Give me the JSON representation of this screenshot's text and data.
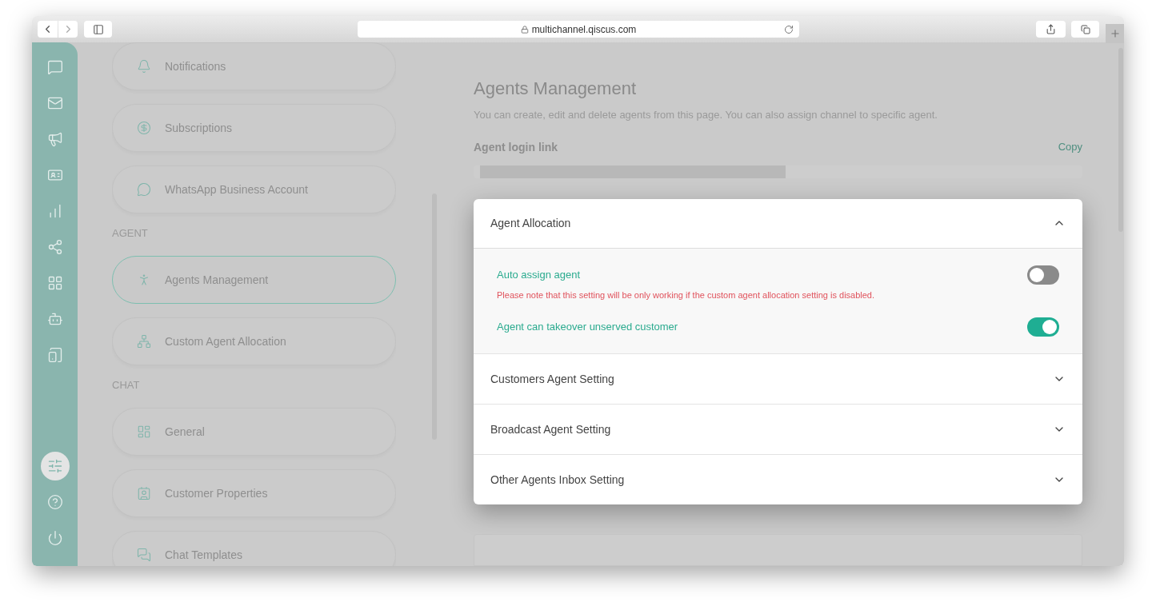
{
  "browser": {
    "url": "multichannel.qiscus.com"
  },
  "rail": {
    "top": [
      {
        "selected": false
      },
      {
        "selected": false
      },
      {
        "selected": false
      },
      {
        "selected": false
      },
      {
        "selected": false
      },
      {
        "selected": false
      },
      {
        "selected": false
      },
      {
        "selected": false
      },
      {
        "selected": false
      }
    ],
    "bottom": [
      {
        "selected": true
      },
      {
        "selected": false
      },
      {
        "selected": false
      }
    ]
  },
  "settings_menu": [
    {
      "items": [
        {
          "label": "Notifications",
          "selected": false
        },
        {
          "label": "Subscriptions",
          "selected": false
        },
        {
          "label": "WhatsApp Business Account",
          "selected": false
        }
      ]
    },
    {
      "heading": "AGENT",
      "items": [
        {
          "label": "Agents Management",
          "selected": true
        },
        {
          "label": "Custom Agent Allocation",
          "selected": false
        }
      ]
    },
    {
      "heading": "CHAT",
      "items": [
        {
          "label": "General",
          "selected": false
        },
        {
          "label": "Customer Properties",
          "selected": false
        },
        {
          "label": "Chat Templates",
          "selected": false
        }
      ]
    }
  ],
  "page": {
    "title": "Agents Management",
    "description": "You can create, edit and delete agents from this page. You can also assign channel to specific agent.",
    "login_link": {
      "label": "Agent login link",
      "action": "Copy"
    }
  },
  "modal": {
    "panels": [
      {
        "title": "Agent Allocation",
        "expanded": true,
        "settings": [
          {
            "label": "Auto assign agent",
            "on": false,
            "note": "Please note that this setting will be only working if the custom agent allocation setting is disabled."
          },
          {
            "label": "Agent can takeover unserved customer",
            "on": true
          }
        ]
      },
      {
        "title": "Customers Agent Setting",
        "expanded": false
      },
      {
        "title": "Broadcast Agent Setting",
        "expanded": false
      },
      {
        "title": "Other Agents Inbox Setting",
        "expanded": false
      }
    ]
  }
}
